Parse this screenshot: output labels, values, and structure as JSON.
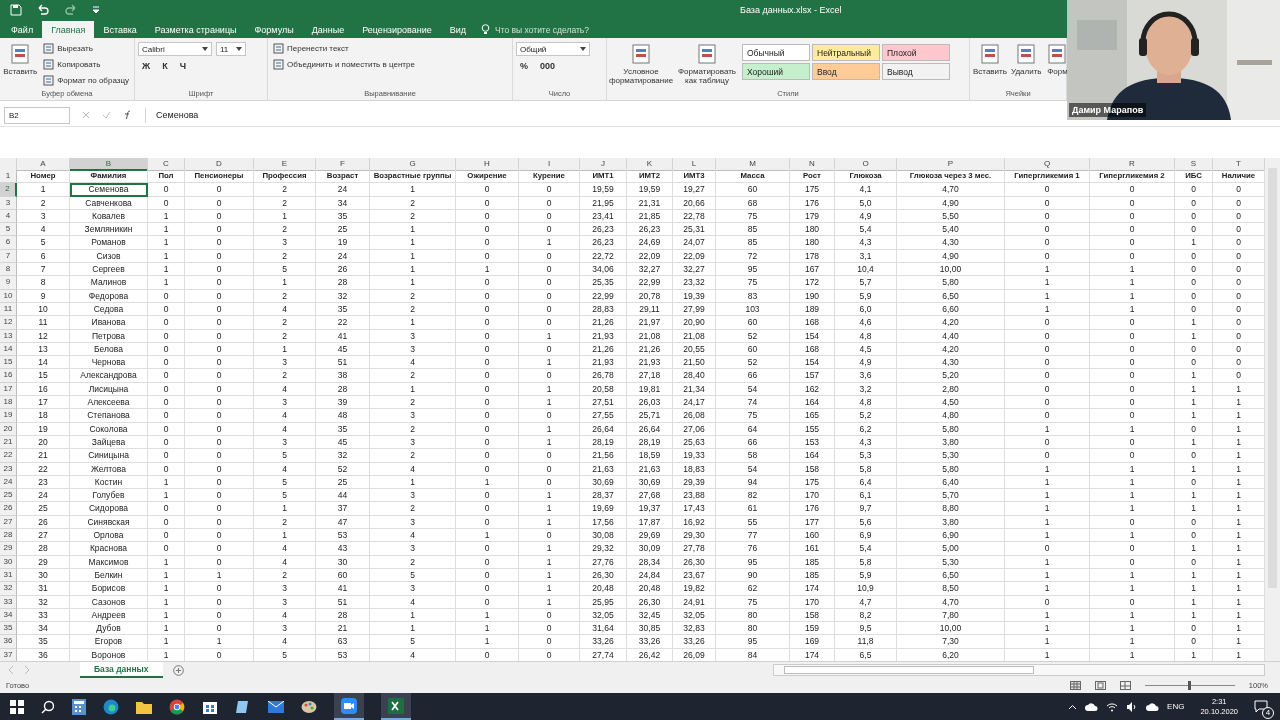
{
  "window": {
    "title": "База данных.xlsx - Excel"
  },
  "ribbon_tabs": [
    {
      "label": "Файл",
      "selected": false
    },
    {
      "label": "Главная",
      "selected": true
    },
    {
      "label": "Вставка",
      "selected": false
    },
    {
      "label": "Разметка страницы",
      "selected": false
    },
    {
      "label": "Формулы",
      "selected": false
    },
    {
      "label": "Данные",
      "selected": false
    },
    {
      "label": "Рецензирование",
      "selected": false
    },
    {
      "label": "Вид",
      "selected": false
    }
  ],
  "tell_me": {
    "placeholder": "Что вы хотите сделать?"
  },
  "ribbon_groups": [
    {
      "name": "Буфер обмена",
      "large": [
        {
          "label": "Вставить"
        }
      ],
      "rows": [
        [
          {
            "kind": "button",
            "label": "Вырезать"
          }
        ],
        [
          {
            "kind": "button",
            "label": "Копировать"
          }
        ],
        [
          {
            "kind": "button",
            "label": "Формат по образцу"
          }
        ]
      ]
    },
    {
      "name": "Шрифт",
      "rows": [
        [
          {
            "kind": "dropdown",
            "label": "Calibri"
          },
          {
            "kind": "dropdown",
            "label": "11"
          }
        ],
        [
          {
            "kind": "toggle",
            "label": "Ж"
          },
          {
            "kind": "toggle",
            "label": "К"
          },
          {
            "kind": "toggle",
            "label": "Ч"
          }
        ]
      ]
    },
    {
      "name": "Выравнивание",
      "rows": [
        [
          {
            "kind": "button",
            "label": "Перенести текст"
          }
        ],
        [
          {
            "kind": "button",
            "label": "Объединить и поместить в центре"
          }
        ]
      ]
    },
    {
      "name": "Число",
      "rows": [
        [
          {
            "kind": "dropdown",
            "label": "Общий"
          }
        ],
        [
          {
            "kind": "toggle",
            "label": "%"
          },
          {
            "kind": "toggle",
            "label": "000"
          }
        ]
      ]
    },
    {
      "name": "Стили",
      "large": [
        {
          "label": "Условное форматирование"
        },
        {
          "label": "Форматировать как таблицу"
        }
      ],
      "styles": [
        {
          "label": "Обычный",
          "color": "#ffffff"
        },
        {
          "label": "Нейтральный",
          "color": "#ffeb9c"
        },
        {
          "label": "Плохой",
          "color": "#ffc7ce"
        },
        {
          "label": "Хороший",
          "color": "#c6efce"
        },
        {
          "label": "Ввод",
          "color": "#ffcc99"
        },
        {
          "label": "Вывод",
          "color": "#f2f2f2"
        }
      ]
    },
    {
      "name": "Ячейки",
      "large": [
        {
          "label": "Вставить"
        },
        {
          "label": "Удалить"
        },
        {
          "label": "Форм"
        }
      ]
    }
  ],
  "formula_bar": {
    "name_box": "B2",
    "value": "Семенова"
  },
  "sheet": {
    "header_row_number": "1",
    "columns": [
      {
        "letter": "A",
        "header": "Номер",
        "selected": false
      },
      {
        "letter": "B",
        "header": "Фамилия",
        "selected": true
      },
      {
        "letter": "C",
        "header": "Пол",
        "selected": false
      },
      {
        "letter": "D",
        "header": "Пенсионеры",
        "selected": false
      },
      {
        "letter": "E",
        "header": "Профессия",
        "selected": false
      },
      {
        "letter": "F",
        "header": "Возраст",
        "selected": false
      },
      {
        "letter": "G",
        "header": "Возрастные группы",
        "selected": false
      },
      {
        "letter": "H",
        "header": "Ожирение",
        "selected": false
      },
      {
        "letter": "I",
        "header": "Курение",
        "selected": false
      },
      {
        "letter": "J",
        "header": "ИМТ1",
        "selected": false
      },
      {
        "letter": "K",
        "header": "ИМТ2",
        "selected": false
      },
      {
        "letter": "L",
        "header": "ИМТ3",
        "selected": false
      },
      {
        "letter": "M",
        "header": "Масса",
        "selected": false
      },
      {
        "letter": "N",
        "header": "Рост",
        "selected": false
      },
      {
        "letter": "O",
        "header": "Глюкоза",
        "selected": false
      },
      {
        "letter": "P",
        "header": "Глюкоза через 3 мес.",
        "selected": false
      },
      {
        "letter": "Q",
        "header": "Гипергликемия 1",
        "selected": false
      },
      {
        "letter": "R",
        "header": "Гипергликемия 2",
        "selected": false
      },
      {
        "letter": "S",
        "header": "ИБС",
        "selected": false
      },
      {
        "letter": "T",
        "header": "Наличие",
        "selected": false
      }
    ],
    "rows": [
      {
        "number": "2",
        "selected": true,
        "cells": [
          "1",
          "Семенова",
          "0",
          "0",
          "2",
          "24",
          "1",
          "0",
          "0",
          "19,59",
          "19,59",
          "19,27",
          "60",
          "175",
          "4,1",
          "4,70",
          "0",
          "0",
          "0",
          "0"
        ]
      },
      {
        "number": "3",
        "selected": false,
        "cells": [
          "2",
          "Савченкова",
          "0",
          "0",
          "2",
          "34",
          "2",
          "0",
          "0",
          "21,95",
          "21,31",
          "20,66",
          "68",
          "176",
          "5,0",
          "4,90",
          "0",
          "0",
          "0",
          "0"
        ]
      },
      {
        "number": "4",
        "selected": false,
        "cells": [
          "3",
          "Ковалев",
          "1",
          "0",
          "1",
          "35",
          "2",
          "0",
          "0",
          "23,41",
          "21,85",
          "22,78",
          "75",
          "179",
          "4,9",
          "5,50",
          "0",
          "0",
          "0",
          "0"
        ]
      },
      {
        "number": "5",
        "selected": false,
        "cells": [
          "4",
          "Земляникин",
          "1",
          "0",
          "2",
          "25",
          "1",
          "0",
          "0",
          "26,23",
          "26,23",
          "25,31",
          "85",
          "180",
          "5,4",
          "5,40",
          "0",
          "0",
          "0",
          "0"
        ]
      },
      {
        "number": "6",
        "selected": false,
        "cells": [
          "5",
          "Романов",
          "1",
          "0",
          "3",
          "19",
          "1",
          "0",
          "1",
          "26,23",
          "24,69",
          "24,07",
          "85",
          "180",
          "4,3",
          "4,30",
          "0",
          "0",
          "1",
          "0"
        ]
      },
      {
        "number": "7",
        "selected": false,
        "cells": [
          "6",
          "Сизов",
          "1",
          "0",
          "2",
          "24",
          "1",
          "0",
          "0",
          "22,72",
          "22,09",
          "22,09",
          "72",
          "178",
          "3,1",
          "4,90",
          "0",
          "0",
          "0",
          "0"
        ]
      },
      {
        "number": "8",
        "selected": false,
        "cells": [
          "7",
          "Сергеев",
          "1",
          "0",
          "5",
          "26",
          "1",
          "1",
          "0",
          "34,06",
          "32,27",
          "32,27",
          "95",
          "167",
          "10,4",
          "10,00",
          "1",
          "1",
          "0",
          "0"
        ]
      },
      {
        "number": "9",
        "selected": false,
        "cells": [
          "8",
          "Малинов",
          "1",
          "0",
          "1",
          "28",
          "1",
          "0",
          "0",
          "25,35",
          "22,99",
          "23,32",
          "75",
          "172",
          "5,7",
          "5,80",
          "1",
          "1",
          "0",
          "0"
        ]
      },
      {
        "number": "10",
        "selected": false,
        "cells": [
          "9",
          "Федорова",
          "0",
          "0",
          "2",
          "32",
          "2",
          "0",
          "0",
          "22,99",
          "20,78",
          "19,39",
          "83",
          "190",
          "5,9",
          "6,50",
          "1",
          "1",
          "0",
          "0"
        ]
      },
      {
        "number": "11",
        "selected": false,
        "cells": [
          "10",
          "Седова",
          "0",
          "0",
          "4",
          "35",
          "2",
          "0",
          "0",
          "28,83",
          "29,11",
          "27,99",
          "103",
          "189",
          "6,0",
          "6,60",
          "1",
          "1",
          "0",
          "0"
        ]
      },
      {
        "number": "12",
        "selected": false,
        "cells": [
          "11",
          "Иванова",
          "0",
          "0",
          "2",
          "22",
          "1",
          "0",
          "0",
          "21,26",
          "21,97",
          "20,90",
          "60",
          "168",
          "4,6",
          "4,20",
          "0",
          "0",
          "1",
          "0"
        ]
      },
      {
        "number": "13",
        "selected": false,
        "cells": [
          "12",
          "Петрова",
          "0",
          "0",
          "2",
          "41",
          "3",
          "0",
          "1",
          "21,93",
          "21,08",
          "21,08",
          "52",
          "154",
          "4,8",
          "4,40",
          "0",
          "0",
          "1",
          "0"
        ]
      },
      {
        "number": "14",
        "selected": false,
        "cells": [
          "13",
          "Белова",
          "0",
          "0",
          "1",
          "45",
          "3",
          "0",
          "0",
          "21,26",
          "21,26",
          "20,55",
          "60",
          "168",
          "4,5",
          "4,20",
          "0",
          "0",
          "0",
          "0"
        ]
      },
      {
        "number": "15",
        "selected": false,
        "cells": [
          "14",
          "Чернова",
          "0",
          "0",
          "3",
          "51",
          "4",
          "0",
          "1",
          "21,93",
          "21,93",
          "21,50",
          "52",
          "154",
          "4,9",
          "4,30",
          "0",
          "0",
          "0",
          "0"
        ]
      },
      {
        "number": "16",
        "selected": false,
        "cells": [
          "15",
          "Александрова",
          "0",
          "0",
          "2",
          "38",
          "2",
          "0",
          "0",
          "26,78",
          "27,18",
          "28,40",
          "66",
          "157",
          "3,6",
          "5,20",
          "0",
          "0",
          "1",
          "0"
        ]
      },
      {
        "number": "17",
        "selected": false,
        "cells": [
          "16",
          "Лисицына",
          "0",
          "0",
          "4",
          "28",
          "1",
          "0",
          "1",
          "20,58",
          "19,81",
          "21,34",
          "54",
          "162",
          "3,2",
          "2,80",
          "0",
          "0",
          "1",
          "1"
        ]
      },
      {
        "number": "18",
        "selected": false,
        "cells": [
          "17",
          "Алексеева",
          "0",
          "0",
          "3",
          "39",
          "2",
          "0",
          "1",
          "27,51",
          "26,03",
          "24,17",
          "74",
          "164",
          "4,8",
          "4,50",
          "0",
          "0",
          "1",
          "1"
        ]
      },
      {
        "number": "19",
        "selected": false,
        "cells": [
          "18",
          "Степанова",
          "0",
          "0",
          "4",
          "48",
          "3",
          "0",
          "0",
          "27,55",
          "25,71",
          "26,08",
          "75",
          "165",
          "5,2",
          "4,80",
          "0",
          "0",
          "1",
          "1"
        ]
      },
      {
        "number": "20",
        "selected": false,
        "cells": [
          "19",
          "Соколова",
          "0",
          "0",
          "4",
          "35",
          "2",
          "0",
          "1",
          "26,64",
          "26,64",
          "27,06",
          "64",
          "155",
          "6,2",
          "5,80",
          "1",
          "1",
          "0",
          "1"
        ]
      },
      {
        "number": "21",
        "selected": false,
        "cells": [
          "20",
          "Зайцева",
          "0",
          "0",
          "3",
          "45",
          "3",
          "0",
          "1",
          "28,19",
          "28,19",
          "25,63",
          "66",
          "153",
          "4,3",
          "3,80",
          "0",
          "0",
          "1",
          "1"
        ]
      },
      {
        "number": "22",
        "selected": false,
        "cells": [
          "21",
          "Синицына",
          "0",
          "0",
          "5",
          "32",
          "2",
          "0",
          "0",
          "21,56",
          "18,59",
          "19,33",
          "58",
          "164",
          "5,3",
          "5,30",
          "0",
          "0",
          "0",
          "1"
        ]
      },
      {
        "number": "23",
        "selected": false,
        "cells": [
          "22",
          "Желтова",
          "0",
          "0",
          "4",
          "52",
          "4",
          "0",
          "0",
          "21,63",
          "21,63",
          "18,83",
          "54",
          "158",
          "5,8",
          "5,80",
          "1",
          "1",
          "1",
          "1"
        ]
      },
      {
        "number": "24",
        "selected": false,
        "cells": [
          "23",
          "Костин",
          "1",
          "0",
          "5",
          "25",
          "1",
          "1",
          "0",
          "30,69",
          "30,69",
          "29,39",
          "94",
          "175",
          "6,4",
          "6,40",
          "1",
          "1",
          "0",
          "1"
        ]
      },
      {
        "number": "25",
        "selected": false,
        "cells": [
          "24",
          "Голубев",
          "1",
          "0",
          "5",
          "44",
          "3",
          "0",
          "1",
          "28,37",
          "27,68",
          "23,88",
          "82",
          "170",
          "6,1",
          "5,70",
          "1",
          "1",
          "1",
          "1"
        ]
      },
      {
        "number": "26",
        "selected": false,
        "cells": [
          "25",
          "Сидорова",
          "0",
          "0",
          "1",
          "37",
          "2",
          "0",
          "1",
          "19,69",
          "19,37",
          "17,43",
          "61",
          "176",
          "9,7",
          "8,80",
          "1",
          "1",
          "1",
          "1"
        ]
      },
      {
        "number": "27",
        "selected": false,
        "cells": [
          "26",
          "Синявская",
          "0",
          "0",
          "2",
          "47",
          "3",
          "0",
          "1",
          "17,56",
          "17,87",
          "16,92",
          "55",
          "177",
          "5,6",
          "3,80",
          "1",
          "0",
          "0",
          "1"
        ]
      },
      {
        "number": "28",
        "selected": false,
        "cells": [
          "27",
          "Орлова",
          "0",
          "0",
          "1",
          "53",
          "4",
          "1",
          "0",
          "30,08",
          "29,69",
          "29,30",
          "77",
          "160",
          "6,9",
          "6,90",
          "1",
          "1",
          "0",
          "1"
        ]
      },
      {
        "number": "29",
        "selected": false,
        "cells": [
          "28",
          "Краснова",
          "0",
          "0",
          "4",
          "43",
          "3",
          "0",
          "1",
          "29,32",
          "30,09",
          "27,78",
          "76",
          "161",
          "5,4",
          "5,00",
          "0",
          "0",
          "1",
          "1"
        ]
      },
      {
        "number": "30",
        "selected": false,
        "cells": [
          "29",
          "Максимов",
          "1",
          "0",
          "4",
          "30",
          "2",
          "0",
          "1",
          "27,76",
          "28,34",
          "26,30",
          "95",
          "185",
          "5,8",
          "5,30",
          "1",
          "0",
          "0",
          "1"
        ]
      },
      {
        "number": "31",
        "selected": false,
        "cells": [
          "30",
          "Белкин",
          "1",
          "1",
          "2",
          "60",
          "5",
          "0",
          "1",
          "26,30",
          "24,84",
          "23,67",
          "90",
          "185",
          "5,9",
          "6,50",
          "1",
          "1",
          "1",
          "1"
        ]
      },
      {
        "number": "32",
        "selected": false,
        "cells": [
          "31",
          "Борисов",
          "1",
          "0",
          "3",
          "41",
          "3",
          "0",
          "1",
          "20,48",
          "20,48",
          "19,82",
          "62",
          "174",
          "10,9",
          "8,50",
          "1",
          "1",
          "1",
          "1"
        ]
      },
      {
        "number": "33",
        "selected": false,
        "cells": [
          "32",
          "Сазонов",
          "1",
          "0",
          "3",
          "51",
          "4",
          "0",
          "1",
          "25,95",
          "26,30",
          "24,91",
          "75",
          "170",
          "4,7",
          "4,70",
          "0",
          "0",
          "1",
          "1"
        ]
      },
      {
        "number": "34",
        "selected": false,
        "cells": [
          "33",
          "Андреев",
          "1",
          "0",
          "4",
          "28",
          "1",
          "1",
          "0",
          "32,05",
          "32,45",
          "32,05",
          "80",
          "158",
          "8,2",
          "7,80",
          "1",
          "1",
          "1",
          "1"
        ]
      },
      {
        "number": "35",
        "selected": false,
        "cells": [
          "34",
          "Дубов",
          "1",
          "0",
          "3",
          "21",
          "1",
          "1",
          "0",
          "31,64",
          "30,85",
          "32,83",
          "80",
          "159",
          "9,5",
          "10,00",
          "1",
          "1",
          "0",
          "1"
        ]
      },
      {
        "number": "36",
        "selected": false,
        "cells": [
          "35",
          "Егоров",
          "1",
          "1",
          "4",
          "63",
          "5",
          "1",
          "0",
          "33,26",
          "33,26",
          "33,26",
          "95",
          "169",
          "11,8",
          "7,30",
          "1",
          "1",
          "0",
          "1"
        ]
      },
      {
        "number": "37",
        "selected": false,
        "cells": [
          "36",
          "Воронов",
          "1",
          "0",
          "5",
          "53",
          "4",
          "0",
          "0",
          "27,74",
          "26,42",
          "26,09",
          "84",
          "174",
          "6,5",
          "6,20",
          "1",
          "1",
          "1",
          "1"
        ]
      }
    ]
  },
  "sheet_tabs": [
    {
      "label": "База данных",
      "selected": true
    }
  ],
  "status_bar": {
    "status": "Готово",
    "zoom": "100%",
    "zoom_slider": {
      "level": 0.5
    }
  },
  "taskbar": {
    "language": "ENG",
    "time": "2:31",
    "date": "20.10.2020",
    "notifications": "4"
  },
  "webcam": {
    "name": "Дамир Марапов"
  }
}
